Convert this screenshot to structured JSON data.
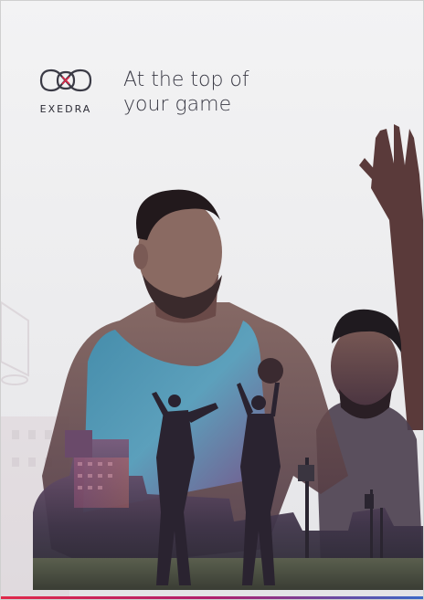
{
  "brand": {
    "name": "EXEDRA",
    "logo_icon": "interlocking-rings-icon"
  },
  "tagline": {
    "line1": "At the top of",
    "line2": "your game"
  },
  "colors": {
    "accent_red": "#e0294a",
    "accent_blue": "#3a68c7",
    "text": "#3a3a45"
  },
  "image": {
    "subject": "basketball-players-double-exposure"
  }
}
